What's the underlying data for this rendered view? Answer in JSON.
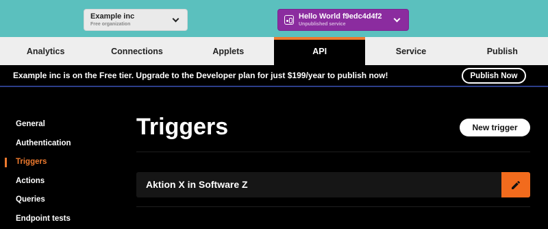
{
  "org": {
    "name": "Example inc",
    "plan": "Free organization"
  },
  "service": {
    "name": "Hello World f9edc4d4f2",
    "status": "Unpublished service",
    "color": "#8b2c9f"
  },
  "nav": {
    "tabs": [
      {
        "label": "Analytics"
      },
      {
        "label": "Connections"
      },
      {
        "label": "Applets"
      },
      {
        "label": "API",
        "active": true
      },
      {
        "label": "Service"
      },
      {
        "label": "Publish"
      }
    ]
  },
  "banner": {
    "message": "Example inc is on the Free tier. Upgrade to the Developer plan for just $199/year to publish now!",
    "button": "Publish Now"
  },
  "sidebar": {
    "items": [
      {
        "label": "General"
      },
      {
        "label": "Authentication"
      },
      {
        "label": "Triggers",
        "active": true
      },
      {
        "label": "Actions"
      },
      {
        "label": "Queries"
      },
      {
        "label": "Endpoint tests"
      }
    ]
  },
  "main": {
    "title": "Triggers",
    "new_button": "New trigger",
    "triggers": [
      {
        "name": "Aktion X in Software Z"
      }
    ]
  },
  "colors": {
    "teal": "#5bc0be",
    "accent": "#ee7a2e",
    "edit": "#f26b1d"
  },
  "icons": {
    "service": "service-icon",
    "edit": "pencil-icon",
    "dropdown": "chevron-down-icon"
  }
}
